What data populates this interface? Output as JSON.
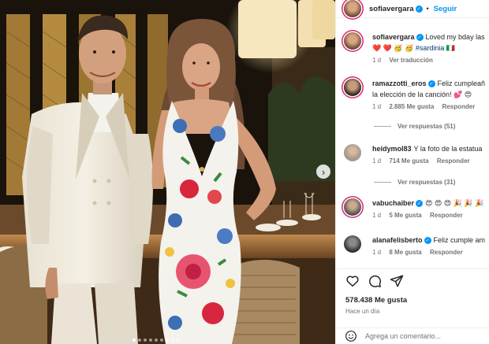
{
  "post": {
    "author": "sofiavergara",
    "follow_label": "Seguir",
    "more_icon": "ellipsis-icon",
    "photo_nav_icon": "chevron-right-icon",
    "caption": {
      "user": "sofiavergara",
      "text": "Loved my bday las",
      "line2": "❤️ ❤️ 🥳 🥳",
      "hashtag": "#sardinia",
      "emoji_after": "🇮🇹",
      "time": "1 d",
      "translate": "Ver traducción"
    },
    "comments": [
      {
        "user": "ramazzotti_eros",
        "verified": true,
        "text": "Feliz cumpleañ",
        "line2": "la elección de la canción! 💕 😍",
        "time": "1 d",
        "likes": "2.885 Me gusta",
        "reply": "Responder",
        "view_replies": "Ver respuestas (51)"
      },
      {
        "user": "heidymol83",
        "verified": false,
        "text": "Y la foto de la estatua",
        "time": "1 d",
        "likes": "714 Me gusta",
        "reply": "Responder",
        "view_replies": "Ver respuestas (31)"
      },
      {
        "user": "vabuchaiber",
        "verified": true,
        "text": "😍 😍 😍 🎉 🎉 🎉",
        "time": "1 d",
        "likes": "5 Me gusta",
        "reply": "Responder"
      },
      {
        "user": "alanafelisberto",
        "verified": true,
        "text": "Feliz cumple am",
        "time": "1 d",
        "likes": "8 Me gusta",
        "reply": "Responder"
      }
    ],
    "actions": {
      "like_icon": "heart-icon",
      "comment_icon": "comment-bubble-icon",
      "share_icon": "paper-plane-icon"
    },
    "likes_total": "578.438 Me gusta",
    "time_ago": "Hace un día",
    "add_comment": {
      "icon": "emoji-smile-icon",
      "placeholder": "Agrega un comentario..."
    },
    "carousel": {
      "total": 9,
      "active": 1
    }
  },
  "colors": {
    "link": "#0095f6",
    "text": "#262626",
    "muted": "#737373",
    "story_ring": "#d62976"
  }
}
